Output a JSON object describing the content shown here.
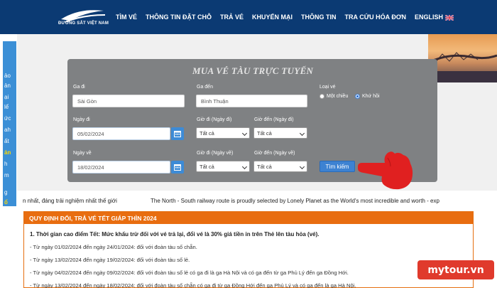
{
  "header": {
    "logo_text": "ĐƯỜNG SẮT VIỆT NAM",
    "logo_mark": "VNR",
    "nav": [
      "TÌM VÉ",
      "THÔNG TIN ĐẶT CHỖ",
      "TRẢ VÉ",
      "KHUYẾN MẠI",
      "THÔNG TIN",
      "TRA CỨU HÓA ĐƠN",
      "ENGLISH"
    ]
  },
  "left_strip": [
    "ảo",
    "ản",
    "ại",
    "lể",
    "ức",
    "ah",
    "ất",
    "ản",
    "h",
    "m",
    "g",
    "ổ"
  ],
  "form": {
    "title": "MUA VÉ TÀU TRỰC TUYẾN",
    "from_label": "Ga đi",
    "from_value": "Sài Gòn",
    "to_label": "Ga đến",
    "to_value": "Bình Thuận",
    "ticket_type_label": "Loại vé",
    "one_way": "Một chiều",
    "round_trip": "Khứ hồi",
    "depart_date_label": "Ngày đi",
    "depart_date": "05/02/2024",
    "depart_time_label": "Giờ đi (Ngày đi)",
    "arrive_time_label": "Giờ đến (Ngày đi)",
    "return_date_label": "Ngày về",
    "return_date": "18/02/2024",
    "return_depart_time_label": "Giờ đi (Ngày về)",
    "return_arrive_time_label": "Giờ đến (Ngày về)",
    "all_option": "Tất cả",
    "search_button": "Tìm kiếm"
  },
  "ticker": {
    "left": "n nhất, đáng trải nghiệm nhất thế giới",
    "right": "The North - South railway route is proudly selected by Lonely Planet as the World's most incredible and worth - exp"
  },
  "notice": {
    "heading": "QUY ĐỊNH ĐỔI, TRẢ VÉ TẾT GIÁP THÌN 2024",
    "lines": [
      "1. Thời gian cao điểm Tết: Mức khấu trừ đối với vé trả lại, đổi vé là 30% giá tiền in trên Thẻ lên tàu hỏa (vé).",
      "- Từ ngày 01/02/2024 đến ngày 24/01/2024: đối với đoàn tàu số chẵn.",
      "- Từ ngày 13/02/2024 đến ngày 19/02/2024: đối với đoàn tàu số lẻ.",
      "- Từ ngày 04/02/2024 đến ngày 09/02/2024: đối với đoàn tàu số lẻ có ga đi là ga Hà Nội và có ga đến từ ga Phủ Lý đến ga Đồng Hới.",
      "- Từ ngày 13/02/2024 đến ngày 18/02/2024: đối với đoàn tàu số chẵn có ga đi từ ga Đồng Hới đến ga Phủ Lý và có ga đến là ga Hà Nội."
    ]
  },
  "watermark": "mytour.vn",
  "colors": {
    "header": "#0b3a73",
    "panel": "#7f8183",
    "accent": "#3d82d2",
    "notice": "#e86d10",
    "pointer": "#e02020"
  }
}
